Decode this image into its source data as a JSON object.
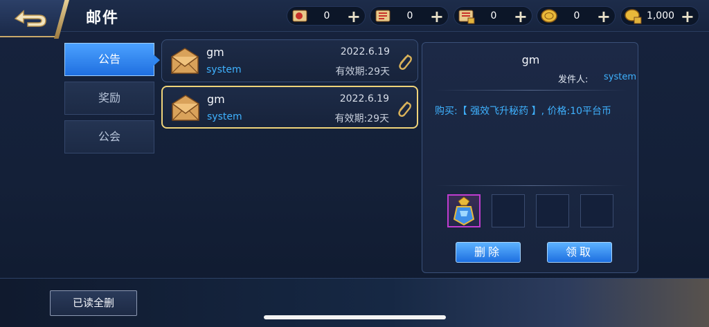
{
  "header": {
    "title": "邮件"
  },
  "currencies": [
    {
      "icon": "scroll-ticket-icon",
      "value": "0"
    },
    {
      "icon": "red-scroll-icon",
      "value": "0"
    },
    {
      "icon": "locked-scroll-icon",
      "value": "0"
    },
    {
      "icon": "gold-coin-icon",
      "value": "0"
    },
    {
      "icon": "locked-coin-icon",
      "value": "1,000"
    }
  ],
  "plus_glyph": "+",
  "tabs": [
    {
      "label": "公告",
      "active": true
    },
    {
      "label": "奖励",
      "active": false
    },
    {
      "label": "公会",
      "active": false
    }
  ],
  "mails": [
    {
      "sender": "gm",
      "from": "system",
      "date": "2022.6.19",
      "expire": "有效期:29天",
      "selected": false
    },
    {
      "sender": "gm",
      "from": "system",
      "date": "2022.6.19",
      "expire": "有效期:29天",
      "selected": true
    }
  ],
  "detail": {
    "title": "gm",
    "sender_label": "发件人:",
    "sender": "system",
    "body": "购买:【 强效飞升秘药 】, 价格:10平台币",
    "attachments": [
      "potion-item-icon",
      "",
      "",
      ""
    ],
    "delete_label": "删除",
    "claim_label": "领取"
  },
  "footer": {
    "read_delete_label": "已读全删"
  },
  "colors": {
    "accent_blue": "#3fb2ff",
    "gold_border": "#f0d47a"
  }
}
